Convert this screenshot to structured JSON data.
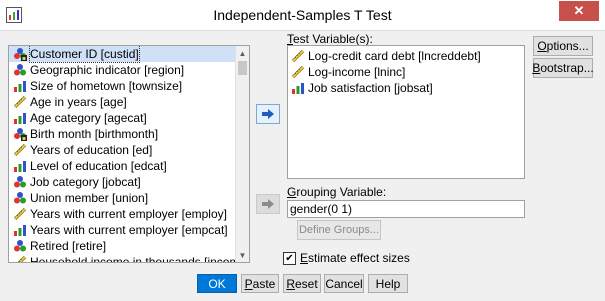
{
  "window": {
    "title": "Independent-Samples T Test",
    "close_label": "✕"
  },
  "source_list": {
    "items": [
      {
        "label": "Customer ID [custid]",
        "icon": "nominal-id-icon",
        "selected": true
      },
      {
        "label": "Geographic indicator [region]",
        "icon": "nominal-icon"
      },
      {
        "label": "Size of hometown [townsize]",
        "icon": "ordinal-icon"
      },
      {
        "label": "Age in years [age]",
        "icon": "scale-icon"
      },
      {
        "label": "Age category [agecat]",
        "icon": "ordinal-icon"
      },
      {
        "label": "Birth month [birthmonth]",
        "icon": "nominal-id-icon"
      },
      {
        "label": "Years of education [ed]",
        "icon": "scale-icon"
      },
      {
        "label": "Level of education [edcat]",
        "icon": "ordinal-icon"
      },
      {
        "label": "Job category [jobcat]",
        "icon": "nominal-icon"
      },
      {
        "label": "Union member [union]",
        "icon": "nominal-icon"
      },
      {
        "label": "Years with current employer [employ]",
        "icon": "scale-icon"
      },
      {
        "label": "Years with current employer [empcat]",
        "icon": "ordinal-icon"
      },
      {
        "label": "Retired [retire]",
        "icon": "nominal-icon"
      },
      {
        "label": "Household income in thousands [income]",
        "icon": "scale-icon"
      }
    ]
  },
  "test_variables": {
    "label": "Test Variable(s):",
    "items": [
      {
        "label": "Log-credit card debt [lncreddebt]",
        "icon": "scale-icon"
      },
      {
        "label": "Log-income [lninc]",
        "icon": "scale-icon"
      },
      {
        "label": "Job satisfaction [jobsat]",
        "icon": "ordinal-icon"
      }
    ]
  },
  "grouping": {
    "label": "Grouping Variable:",
    "value": "gender(0 1)",
    "define_label": "Define Groups..."
  },
  "side_buttons": {
    "options": "Options...",
    "bootstrap": "Bootstrap..."
  },
  "effect_sizes": {
    "label": "Estimate effect sizes",
    "checked": true
  },
  "bottom_buttons": {
    "ok": "OK",
    "paste": "Paste",
    "reset": "Reset",
    "cancel": "Cancel",
    "help": "Help"
  },
  "move_arrow": "➡"
}
